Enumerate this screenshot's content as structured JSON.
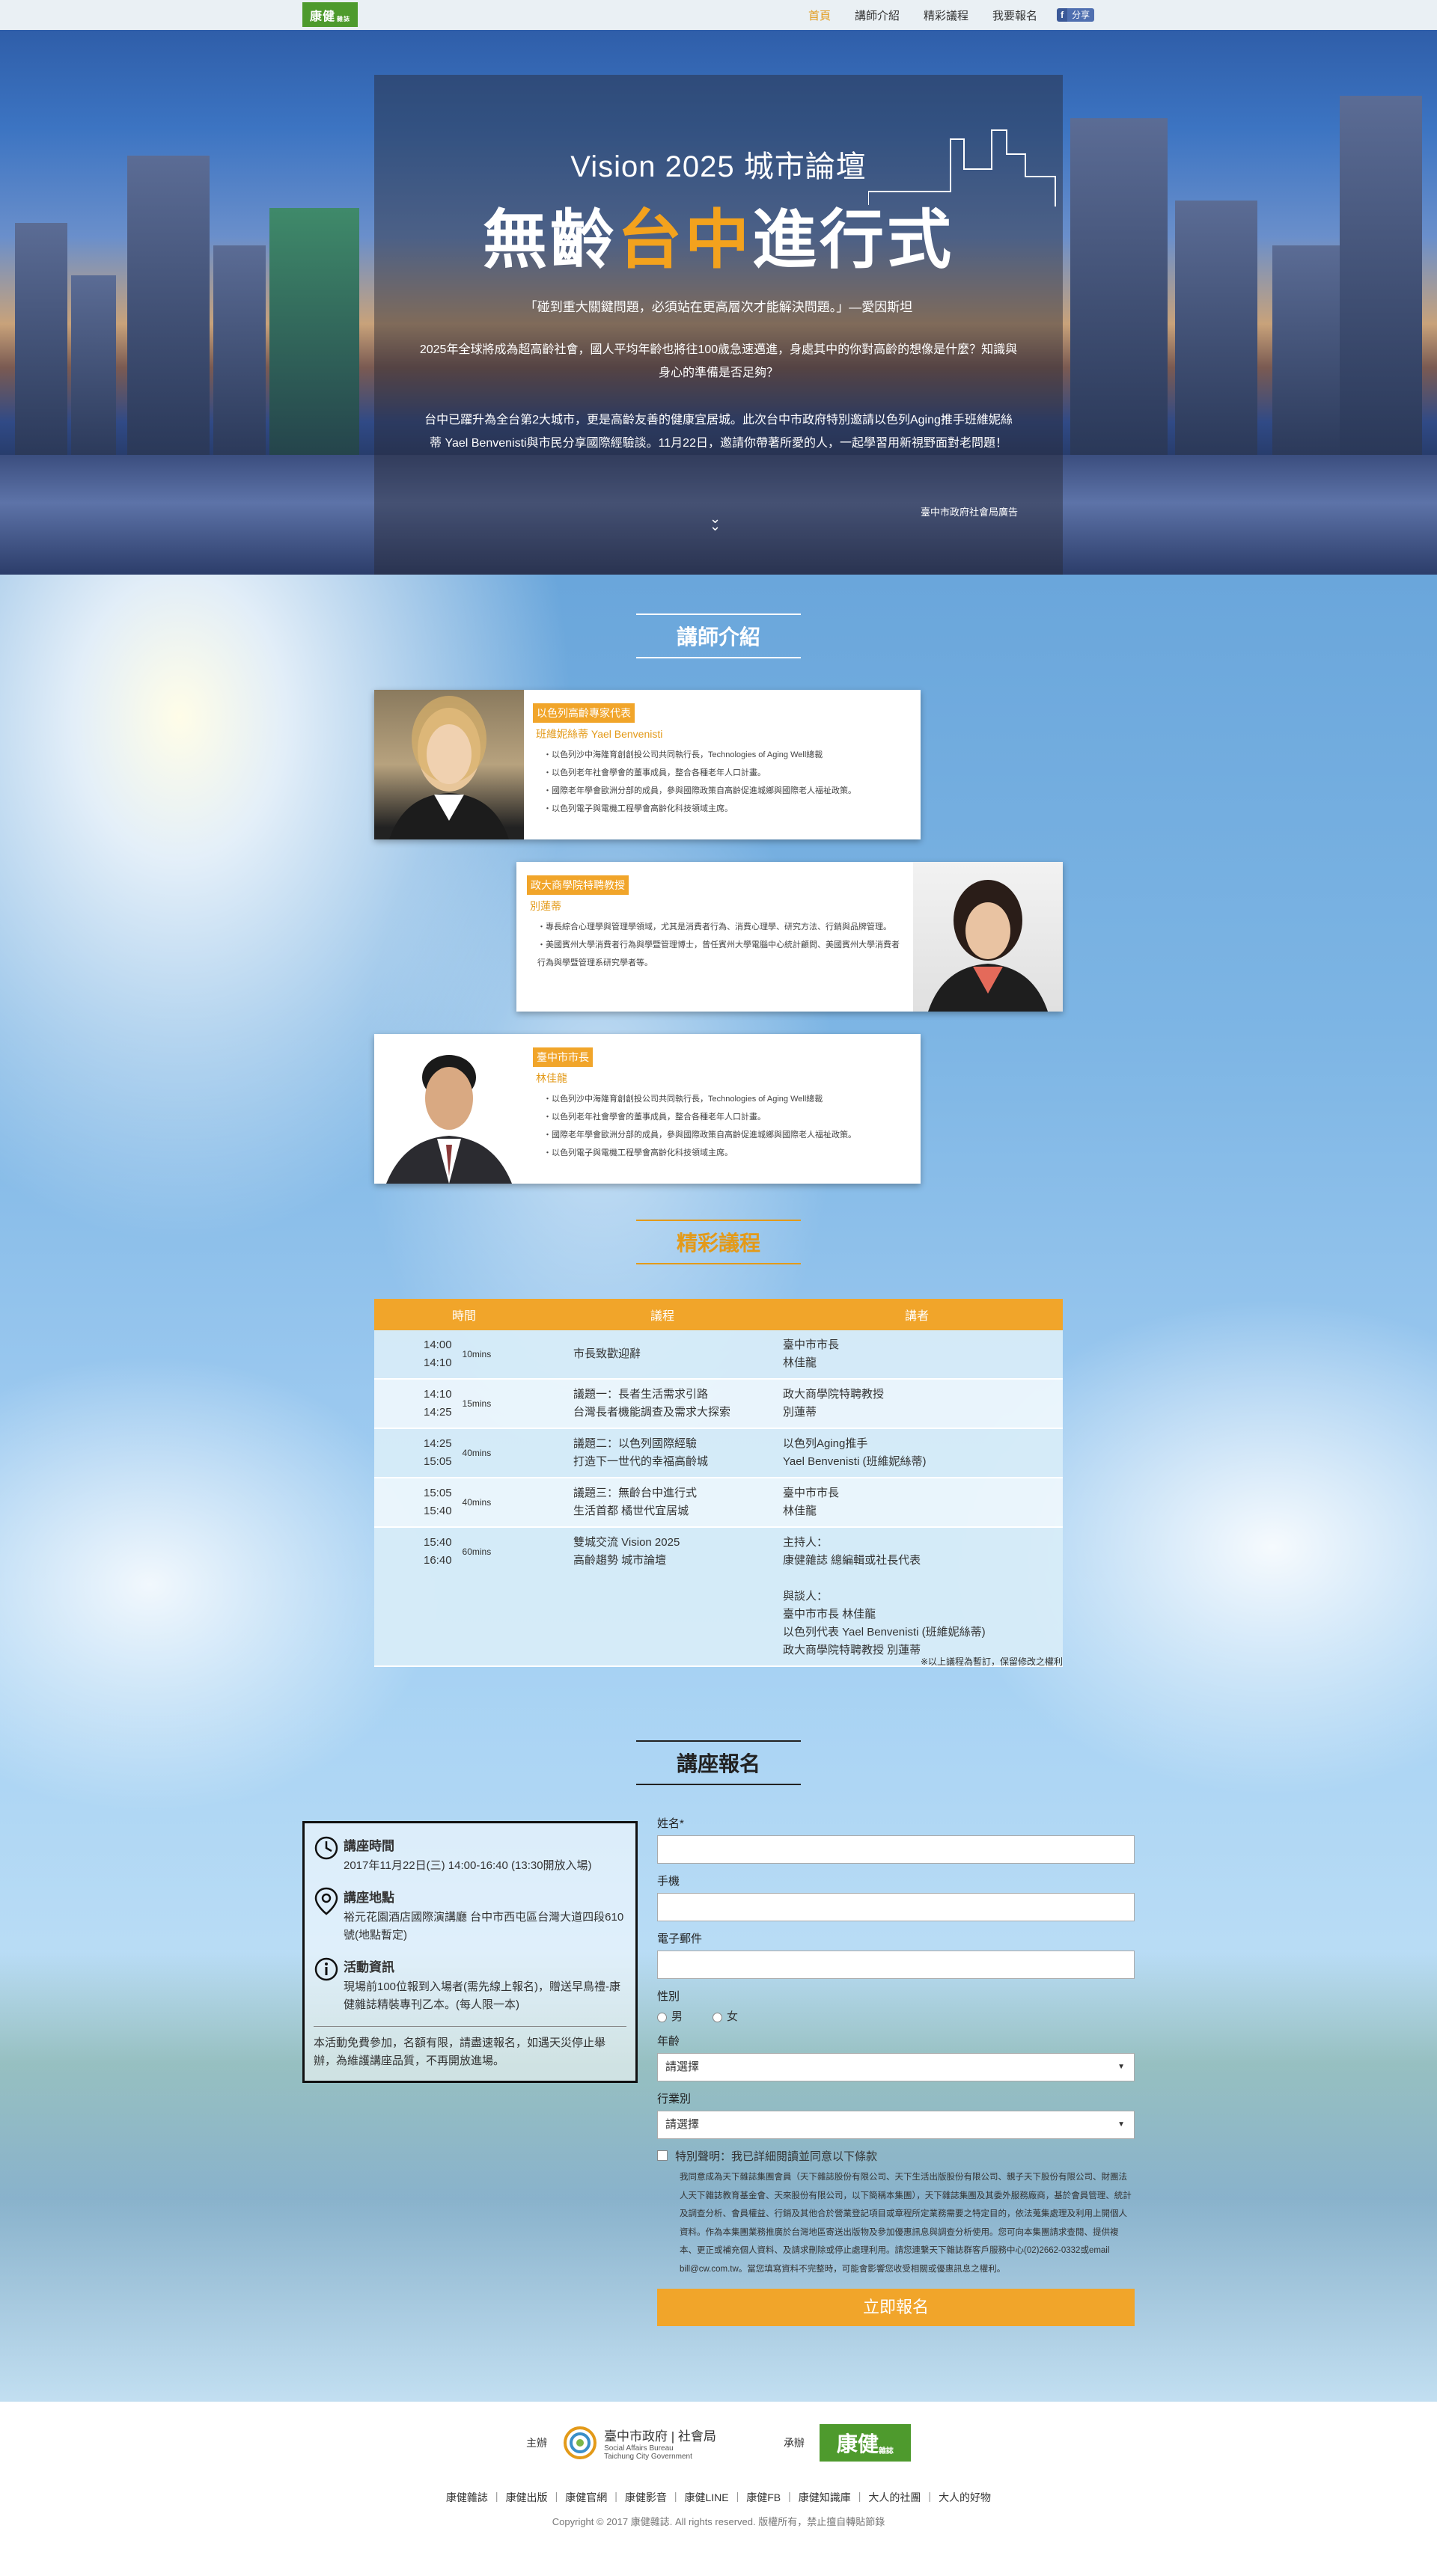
{
  "nav": {
    "logo_text": "康健",
    "logo_sub": "雜誌",
    "links": [
      "首頁",
      "講師介紹",
      "精彩議程",
      "我要報名"
    ],
    "share_f": "f",
    "share_label": "分享"
  },
  "hero": {
    "title1": "Vision 2025 城市論壇",
    "title2_a": "無齡",
    "title2_b": "台中",
    "title2_c": "進行式",
    "quote": "「碰到重大關鍵問題，必須站在更高層次才能解決問題。」—愛因斯坦",
    "para1": "2025年全球將成為超高齡社會，國人平均年齡也將往100歲急速邁進，身處其中的你對高齡的想像是什麼？知識與身心的準備是否足夠？",
    "para2": "台中已躍升為全台第2大城市，更是高齡友善的健康宜居城。此次台中市政府特別邀請以色列Aging推手班維妮絲蒂 Yael Benvenisti與市民分享國際經驗談。11月22日，邀請你帶著所愛的人，一起學習用新視野面對老問題！",
    "source": "臺中市政府社會局廣告"
  },
  "speakers": {
    "title": "講師介紹",
    "items": [
      {
        "tag": "以色列高齡專家代表",
        "name": "班維妮絲蒂 Yael Benvenisti",
        "bio": [
          "・以色列沙中海隆育創創投公司共同執行長，Technologies of Aging Well總裁",
          "・以色列老年社會學會的董事成員，整合各種老年人口計畫。",
          "・國際老年學會歐洲分部的成員，參與國際政策自高齡促進城鄉與國際老人福祉政策。",
          "・以色列電子與電機工程學會高齡化科技領域主席。"
        ]
      },
      {
        "tag": "政大商學院特聘教授",
        "name": "別蓮蒂",
        "bio": [
          "・專長綜合心理學與管理學領域，尤其是消費者行為、消費心理學、研究方法、行銷與品牌管理。",
          "・美國賓州大學消費者行為與學暨管理博士，曾任賓州大學電腦中心統計顧問、美國賓州大學消費者行為與學暨管理系研究學者等。"
        ]
      },
      {
        "tag": "臺中市市長",
        "name": "林佳龍",
        "bio": [
          "・以色列沙中海隆育創創投公司共同執行長，Technologies of Aging Well總裁",
          "・以色列老年社會學會的董事成員，整合各種老年人口計畫。",
          "・國際老年學會歐洲分部的成員，參與國際政策自高齡促進城鄉與國際老人福祉政策。",
          "・以色列電子與電機工程學會高齡化科技領域主席。"
        ]
      }
    ]
  },
  "agenda": {
    "title": "精彩議程",
    "headers": [
      "時間",
      "議程",
      "講者"
    ],
    "rows": [
      {
        "start": "14:00",
        "end": "14:10",
        "dur": "10mins",
        "topic": [
          "市長致歡迎辭"
        ],
        "speaker": [
          "臺中市市長",
          "林佳龍"
        ]
      },
      {
        "start": "14:10",
        "end": "14:25",
        "dur": "15mins",
        "topic": [
          "議題一：長者生活需求引路",
          "台灣長者機能調查及需求大探索"
        ],
        "speaker": [
          "政大商學院特聘教授",
          "別蓮蒂"
        ]
      },
      {
        "start": "14:25",
        "end": "15:05",
        "dur": "40mins",
        "topic": [
          "議題二：以色列國際經驗",
          "打造下一世代的幸福高齡城"
        ],
        "speaker": [
          "以色列Aging推手",
          "Yael Benvenisti (班維妮絲蒂)"
        ]
      },
      {
        "start": "15:05",
        "end": "15:40",
        "dur": "40mins",
        "topic": [
          "議題三：無齡台中進行式",
          "生活首都 橘世代宜居城"
        ],
        "speaker": [
          "臺中市市長",
          "林佳龍"
        ]
      },
      {
        "start": "15:40",
        "end": "16:40",
        "dur": "60mins",
        "topic": [
          "雙城交流 Vision 2025",
          "高齡趨勢 城市論壇"
        ],
        "speaker": [
          "主持人：",
          "康健雜誌 總編輯或社長代表",
          "",
          "與談人：",
          "臺中市市長 林佳龍",
          "以色列代表 Yael Benvenisti (班維妮絲蒂)",
          "政大商學院特聘教授 別蓮蒂"
        ]
      }
    ],
    "note": "※以上議程為暫訂，保留修改之權利"
  },
  "registration": {
    "title": "講座報名",
    "time_title": "講座時間",
    "time_text": "2017年11月22日(三) 14:00-16:40 (13:30開放入場)",
    "place_title": "講座地點",
    "place_text": "裕元花園酒店國際演講廳 台中市西屯區台灣大道四段610號(地點暫定)",
    "info_title": "活動資訊",
    "info_text": "現場前100位報到入場者(需先線上報名)，贈送早鳥禮-康健雜誌精裝專刊乙本。(每人限一本)",
    "note": "本活動免費參加，名額有限，請盡速報名，如遇天災停止舉辦，為維護講座品質，不再開放進場。",
    "labels": {
      "name": "姓名*",
      "phone": "手機",
      "email": "電子郵件",
      "gender": "性別",
      "male": "男",
      "female": "女",
      "age": "年齡",
      "industry": "行業別",
      "select_placeholder": "請選擇"
    },
    "consent": "特別聲明：我已詳細閱讀並同意以下條款",
    "legal": "我同意成為天下雜誌集團會員（天下雜誌股份有限公司、天下生活出版股份有限公司、親子天下股份有限公司、財團法人天下雜誌教育基金會、天來股份有限公司，以下簡稱本集團），天下雜誌集團及其委外服務廠商，基於會員管理、統計及調查分析、會員權益、行銷及其他合於營業登記項目或章程所定業務需要之特定目的，依法蒐集處理及利用上開個人資料。作為本集團業務推廣於台灣地區寄送出版物及參加優惠訊息與調查分析使用。您可向本集團請求查閱、提供複本、更正或補充個人資料、及請求刪除或停止處理利用。請您連繫天下雜誌群客戶服務中心(02)2662-0332或email bill@cw.com.tw。當您填寫資料不完整時，可能會影響您收受相關或優惠訊息之權利。",
    "submit": "立即報名"
  },
  "footer": {
    "host_label": "主辦",
    "host_name": "臺中市政府 | 社會局",
    "host_en1": "Social Affairs Bureau",
    "host_en2": "Taichung City Government",
    "organizer_label": "承辦",
    "organizer_logo": "康健",
    "organizer_logo_sub": "雜誌",
    "links": [
      "康健雜誌",
      "康健出版",
      "康健官網",
      "康健影音",
      "康健LINE",
      "康健FB",
      "康健知識庫",
      "大人的社團",
      "大人的好物"
    ],
    "copyright": "Copyright © 2017 康健雜誌. All rights reserved. 版權所有，禁止擅自轉貼節錄"
  },
  "colors": {
    "accent": "#f1a52a",
    "nav_active": "#e39a19",
    "brand_green": "#4e9a2d"
  }
}
